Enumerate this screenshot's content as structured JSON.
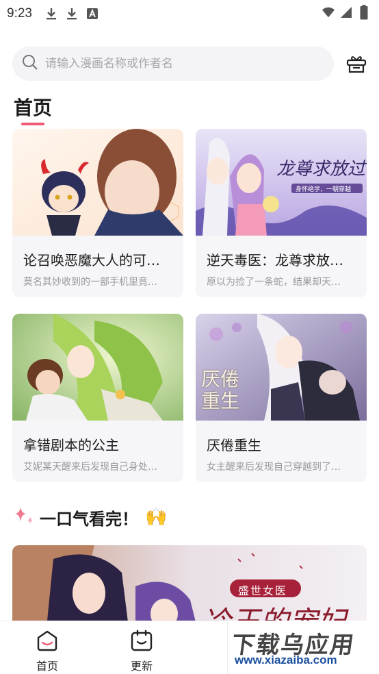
{
  "status_bar": {
    "time": "9:23"
  },
  "search": {
    "placeholder": "请输入漫画名称或作者名"
  },
  "page_title": "首页",
  "cards": [
    {
      "title": "论召唤恶魔大人的可…",
      "desc": "莫名其妙收到的一部手机里竟…"
    },
    {
      "title": "逆天毒医：龙尊求放…",
      "desc": "原以为捡了一条蛇，结果却天…",
      "cover_text": "龙尊求放过",
      "cover_subtext": "身怀绝学，一朝穿越"
    },
    {
      "title": "拿错剧本的公主",
      "desc": "艾妮某天醒来后发现自己身处…"
    },
    {
      "title": "厌倦重生",
      "desc": "女主醒来后发现自己穿越到了…",
      "cover_text": "厌倦重生"
    }
  ],
  "section": {
    "title": "一口气看完！",
    "emoji": "🙌"
  },
  "banner": {
    "badge": "盛世女医",
    "text": "冷王的宠妃"
  },
  "nav": [
    {
      "label": "首页"
    },
    {
      "label": "更新"
    }
  ],
  "watermark": {
    "main": "下载乌应用",
    "sub": "www.xiazaiba.com"
  },
  "colors": {
    "accent": "#f05a74",
    "card_bg": "#f6f6f8",
    "search_bg": "#f4f4f6"
  }
}
